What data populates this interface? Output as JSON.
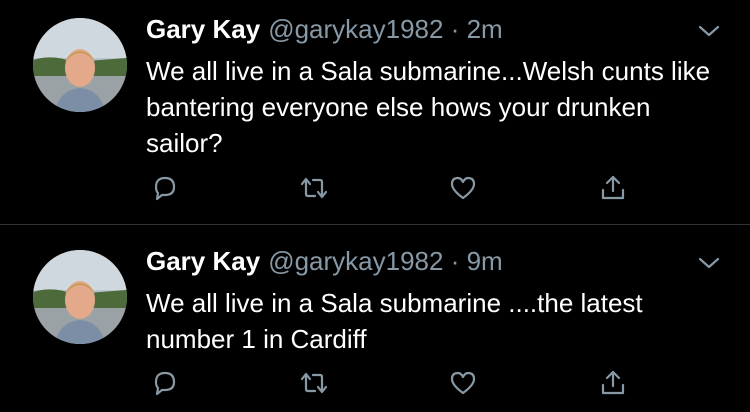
{
  "tweets": [
    {
      "name": "Gary Kay",
      "handle": "@garykay1982",
      "separator": "·",
      "time": "2m",
      "text": "We all live in a Sala submarine...Welsh cunts like bantering everyone else hows your drunken sailor?"
    },
    {
      "name": "Gary Kay",
      "handle": "@garykay1982",
      "separator": "·",
      "time": "9m",
      "text": "We all live in a Sala submarine ....the latest number 1 in Cardiff"
    }
  ],
  "icons": {
    "reply": "reply-icon",
    "retweet": "retweet-icon",
    "like": "heart-icon",
    "share": "share-icon",
    "menu": "chevron-down-icon"
  },
  "colors": {
    "background": "#000000",
    "secondary_text": "#8899a6",
    "divider": "#2f3336"
  }
}
